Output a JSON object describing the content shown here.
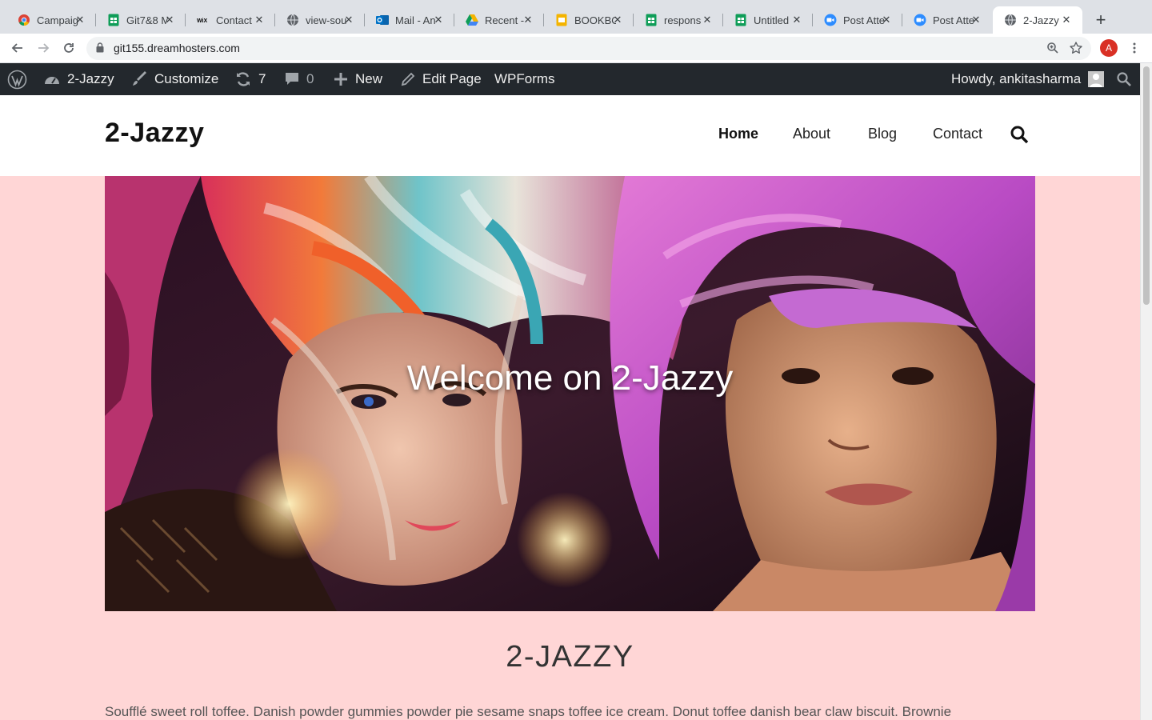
{
  "browser": {
    "tabs": [
      {
        "label": "Campaign",
        "icon": "chrome-logo-icon"
      },
      {
        "label": "Git7&8 M",
        "icon": "sheets-icon"
      },
      {
        "label": "Contact",
        "icon": "wix-icon",
        "icon_text": "WiX"
      },
      {
        "label": "view-sou",
        "icon": "globe-icon"
      },
      {
        "label": "Mail - An",
        "icon": "outlook-icon"
      },
      {
        "label": "Recent -",
        "icon": "drive-icon"
      },
      {
        "label": "BOOKBO",
        "icon": "slides-icon"
      },
      {
        "label": "respons",
        "icon": "sheets-icon"
      },
      {
        "label": "Untitled",
        "icon": "sheets-icon"
      },
      {
        "label": "Post Atte",
        "icon": "zoom-icon"
      },
      {
        "label": "Post Atte",
        "icon": "zoom-icon"
      },
      {
        "label": "2-Jazzy",
        "icon": "globe-icon",
        "active": true
      }
    ],
    "url": "git155.dreamhosters.com",
    "profile_initial": "A"
  },
  "adminbar": {
    "site_name": "2-Jazzy",
    "customize": "Customize",
    "updates_count": "7",
    "comments_count": "0",
    "new_label": "New",
    "edit_page": "Edit Page",
    "wpforms": "WPForms",
    "howdy": "Howdy, ankitasharma"
  },
  "site": {
    "title": "2-Jazzy",
    "menu": [
      {
        "label": "Home",
        "current": true
      },
      {
        "label": "About"
      },
      {
        "label": "Blog"
      },
      {
        "label": "Contact"
      }
    ]
  },
  "hero": {
    "title": "Welcome on 2-Jazzy"
  },
  "content": {
    "section_title": "2-JAZZY",
    "paragraph": "Soufflé sweet roll toffee. Danish powder gummies powder pie sesame snaps toffee ice cream. Donut toffee danish bear claw biscuit. Brownie"
  },
  "colors": {
    "page_background": "#ffd6d6",
    "adminbar": "#23282d",
    "tabstrip": "#dee1e6"
  }
}
